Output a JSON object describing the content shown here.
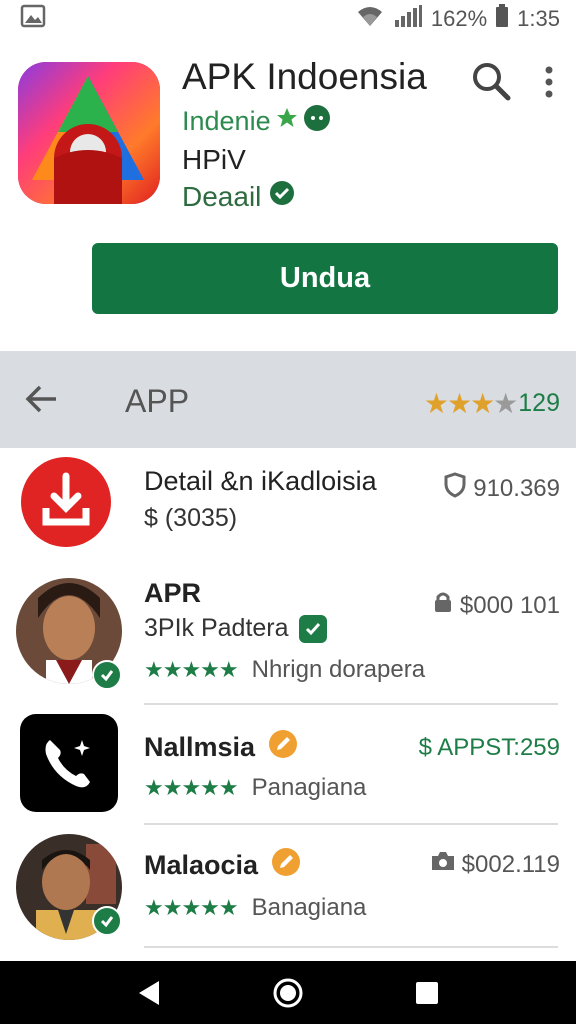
{
  "status_bar": {
    "battery": "162%",
    "time": "1:35",
    "icons": [
      "image-icon",
      "wifi-icon",
      "signal-icon",
      "battery-icon"
    ]
  },
  "header": {
    "app_title": "APK Indoensia",
    "developer": "Indenie",
    "line2": "HPiV",
    "detail": "Deaail",
    "install_label": "Undua"
  },
  "section": {
    "title": "APP",
    "rating_count": "129",
    "stars_filled": 3,
    "stars_total": 4
  },
  "items": [
    {
      "title": "Detail &n iKadloisia",
      "subtitle": "$ (3035)",
      "meta": "910.369",
      "meta_icon": "shield-icon"
    },
    {
      "title": "APR",
      "subtitle": "3PIk Padtera",
      "rating_text": "Nhrign dorapera",
      "meta": "$000 101",
      "meta_icon": "lock-icon"
    },
    {
      "title": "Nallmsia",
      "rating_text": "Panagiana",
      "meta": "$ APPST:259",
      "meta_icon": ""
    },
    {
      "title": "Malaocia",
      "rating_text": "Banagiana",
      "meta": "$002.119",
      "meta_icon": "camera-icon"
    }
  ],
  "colors": {
    "accent_green": "#127542",
    "star_gold": "#e0a12c",
    "section_bg": "#d9dde1"
  }
}
